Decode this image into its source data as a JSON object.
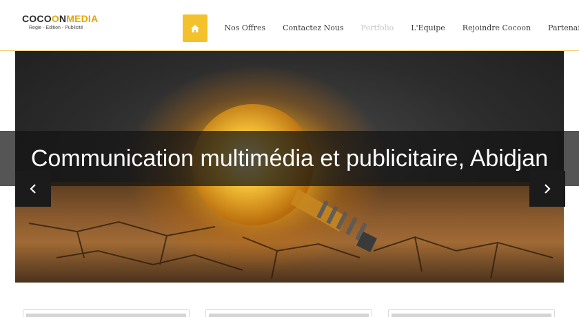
{
  "logo": {
    "name_dark": "COCO",
    "name_mid": "O",
    "name_rest": "N",
    "name_brand": "MEDIA",
    "tagline": "Regie - Edition - Publicité"
  },
  "nav": {
    "home_icon": "home-icon",
    "items": [
      {
        "label": "Nos Offres",
        "state": "normal"
      },
      {
        "label": "Contactez Nous",
        "state": "normal"
      },
      {
        "label": "Portfolio",
        "state": "faded"
      },
      {
        "label": "L'Equipe",
        "state": "normal"
      },
      {
        "label": "Rejoindre Cocoon",
        "state": "normal"
      },
      {
        "label": "Partenaires",
        "state": "normal"
      }
    ]
  },
  "hero": {
    "caption": "Communication multimédia et publicitaire, Abidjan",
    "prev_icon": "chevron-left-icon",
    "next_icon": "chevron-right-icon"
  },
  "colors": {
    "accent": "#f3c12b",
    "brand_gold": "#e5a800",
    "header_border": "#f1cf6a",
    "caption_band": "#141414"
  }
}
